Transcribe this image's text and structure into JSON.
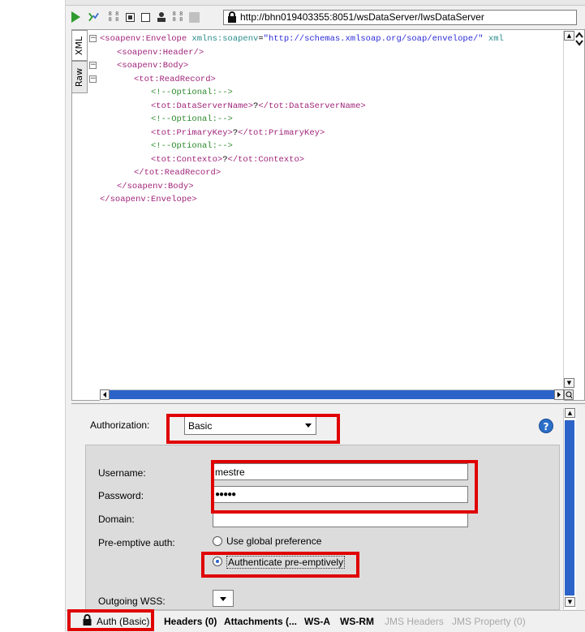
{
  "toolbar": {
    "icons": [
      "run-icon",
      "assertion-icon",
      "option-icon",
      "stop-icon",
      "add-icon",
      "person-icon",
      "option-icon",
      "blank-icon",
      "lock-icon"
    ],
    "url": "http://bhn019403355:8051/wsDataServer/IwsDataServer"
  },
  "editor": {
    "tabs": {
      "xml": "XML",
      "raw": "Raw"
    },
    "lines": [
      {
        "indent": 0,
        "parts": [
          [
            "tag",
            "<soapenv:Envelope "
          ],
          [
            "attr",
            "xmlns:soapenv"
          ],
          [
            "txt",
            "="
          ],
          [
            "str",
            "\"http://schemas.xmlsoap.org/soap/envelope/\""
          ],
          [
            "attr",
            " xml"
          ]
        ]
      },
      {
        "indent": 1,
        "parts": [
          [
            "tag",
            "<soapenv:Header/>"
          ]
        ]
      },
      {
        "indent": 1,
        "parts": [
          [
            "tag",
            "<soapenv:Body>"
          ]
        ]
      },
      {
        "indent": 2,
        "parts": [
          [
            "tag",
            "<tot:ReadRecord>"
          ]
        ]
      },
      {
        "indent": 3,
        "parts": [
          [
            "cmt",
            "<!--Optional:-->"
          ]
        ]
      },
      {
        "indent": 3,
        "parts": [
          [
            "tag",
            "<tot:DataServerName>"
          ],
          [
            "txt",
            "?"
          ],
          [
            "tag",
            "</tot:DataServerName>"
          ]
        ]
      },
      {
        "indent": 3,
        "parts": [
          [
            "cmt",
            "<!--Optional:-->"
          ]
        ]
      },
      {
        "indent": 3,
        "parts": [
          [
            "tag",
            "<tot:PrimaryKey>"
          ],
          [
            "txt",
            "?"
          ],
          [
            "tag",
            "</tot:PrimaryKey>"
          ]
        ]
      },
      {
        "indent": 3,
        "parts": [
          [
            "cmt",
            "<!--Optional:-->"
          ]
        ]
      },
      {
        "indent": 3,
        "parts": [
          [
            "tag",
            "<tot:Contexto>"
          ],
          [
            "txt",
            "?"
          ],
          [
            "tag",
            "</tot:Contexto>"
          ]
        ]
      },
      {
        "indent": 2,
        "parts": [
          [
            "tag",
            "</tot:ReadRecord>"
          ]
        ]
      },
      {
        "indent": 1,
        "parts": [
          [
            "tag",
            "</soapenv:Body>"
          ]
        ]
      },
      {
        "indent": 0,
        "parts": [
          [
            "tag",
            "</soapenv:Envelope>"
          ]
        ]
      }
    ]
  },
  "auth": {
    "authorization_label": "Authorization:",
    "authorization_value": "Basic",
    "username_label": "Username:",
    "username_value": "mestre",
    "password_label": "Password:",
    "password_value": "●●●●●",
    "domain_label": "Domain:",
    "domain_value": "",
    "preemptive_label": "Pre-emptive auth:",
    "preemptive_options": [
      "Use global preference",
      "Authenticate pre-emptively"
    ],
    "preemptive_selected": 1,
    "outgoing_wss_label": "Outgoing WSS:",
    "help_icon": "?"
  },
  "bottom_tabs": [
    {
      "label": "Auth (Basic)",
      "icon": "lock-icon",
      "bold": false,
      "dim": false
    },
    {
      "label": "Headers (0)",
      "bold": true,
      "dim": false
    },
    {
      "label": "Attachments (...",
      "bold": true,
      "dim": false
    },
    {
      "label": "WS-A",
      "bold": true,
      "dim": false
    },
    {
      "label": "WS-RM",
      "bold": true,
      "dim": false
    },
    {
      "label": "JMS Headers",
      "bold": false,
      "dim": true
    },
    {
      "label": "JMS Property (0)",
      "bold": false,
      "dim": true
    }
  ],
  "colors": {
    "annotation": "#e00000",
    "tag": "#a0247a",
    "attr": "#2a8a8a",
    "string": "#2b2bd8",
    "comment": "#2e8b2e",
    "scroll": "#2c63c8"
  }
}
